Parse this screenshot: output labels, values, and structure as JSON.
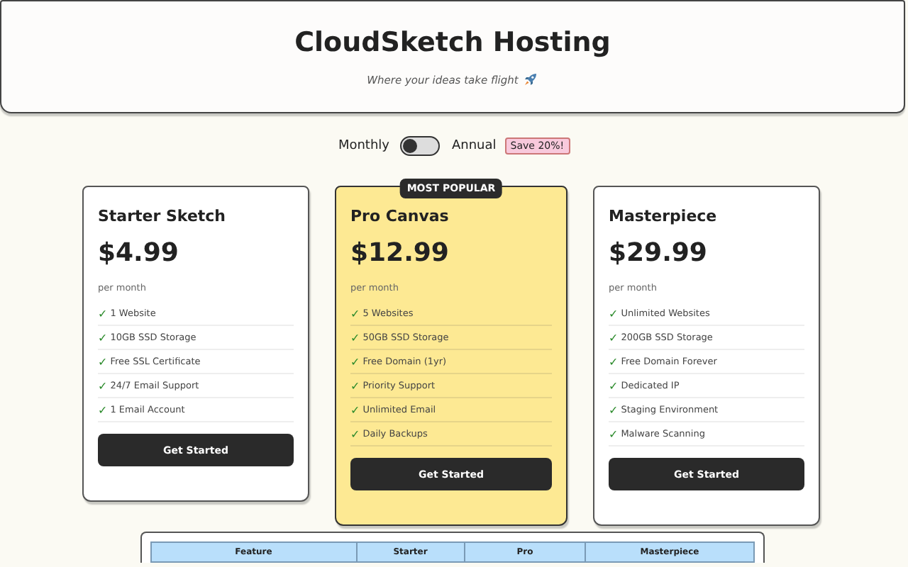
{
  "header": {
    "title": "CloudSketch Hosting",
    "tagline": "Where your ideas take flight"
  },
  "billing": {
    "monthly_label": "Monthly",
    "annual_label": "Annual",
    "annual": false,
    "badge": "Save 20%!"
  },
  "plans": [
    {
      "name": "Starter Sketch",
      "price": "$4.99",
      "period": "per month",
      "featured": false,
      "features": [
        "1 Website",
        "10GB SSD Storage",
        "Free SSL Certificate",
        "24/7 Email Support",
        "1 Email Account"
      ],
      "button": "Get Started"
    },
    {
      "name": "Pro Canvas",
      "price": "$12.99",
      "period": "per month",
      "featured": true,
      "ribbon": "MOST POPULAR",
      "features": [
        "5 Websites",
        "50GB SSD Storage",
        "Free Domain (1yr)",
        "Priority Support",
        "Unlimited Email",
        "Daily Backups"
      ],
      "button": "Get Started"
    },
    {
      "name": "Masterpiece",
      "price": "$29.99",
      "period": "per month",
      "featured": false,
      "features": [
        "Unlimited Websites",
        "200GB SSD Storage",
        "Free Domain Forever",
        "Dedicated IP",
        "Staging Environment",
        "Malware Scanning"
      ],
      "button": "Get Started"
    }
  ],
  "check_mark": "✓",
  "comparison": {
    "columns": [
      "Feature",
      "Starter",
      "Pro",
      "Masterpiece"
    ]
  }
}
